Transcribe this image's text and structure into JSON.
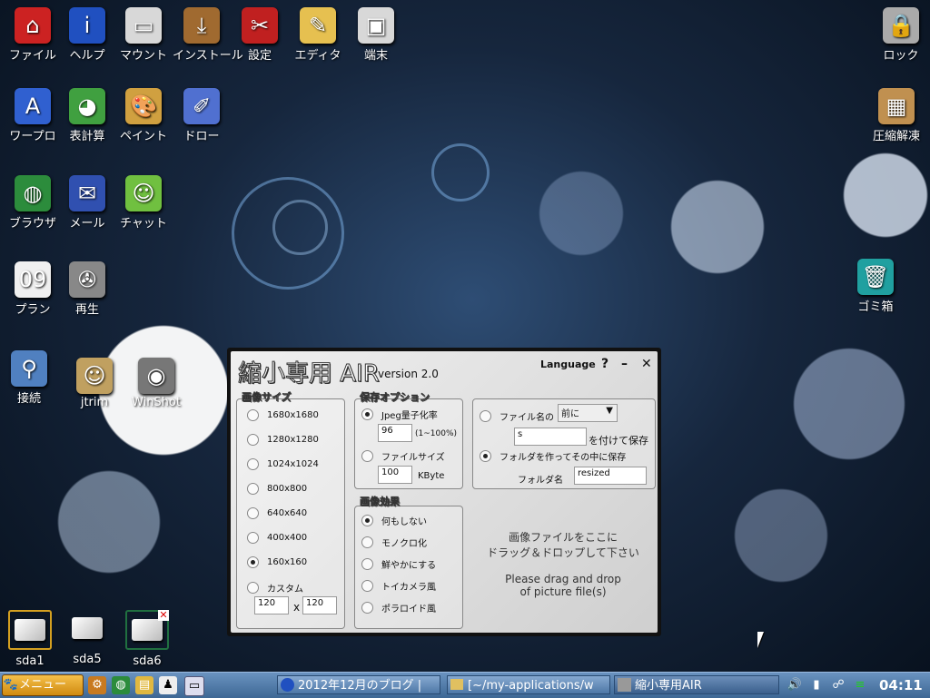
{
  "desktop": {
    "icons": [
      {
        "label": "ファイル",
        "icon": "home-icon",
        "color": "#cc2222",
        "glyph": "⌂"
      },
      {
        "label": "ヘルプ",
        "icon": "info-icon",
        "color": "#2050c0",
        "glyph": "i"
      },
      {
        "label": "マウント",
        "icon": "drive-icon",
        "color": "#d8d8d8",
        "glyph": "▭"
      },
      {
        "label": "インストール",
        "icon": "install-icon",
        "color": "#a06a30",
        "glyph": "⤓"
      },
      {
        "label": "設定",
        "icon": "settings-icon",
        "color": "#c02020",
        "glyph": "✂"
      },
      {
        "label": "エディタ",
        "icon": "editor-icon",
        "color": "#e6c050",
        "glyph": "✎"
      },
      {
        "label": "端末",
        "icon": "terminal-icon",
        "color": "#d8d8d8",
        "glyph": "▣"
      },
      {
        "label": "ワープロ",
        "icon": "wordprocessor-icon",
        "color": "#3060d0",
        "glyph": "A"
      },
      {
        "label": "表計算",
        "icon": "spreadsheet-icon",
        "color": "#40a040",
        "glyph": "◕"
      },
      {
        "label": "ペイント",
        "icon": "paint-icon",
        "color": "#d0a040",
        "glyph": "🎨"
      },
      {
        "label": "ドロー",
        "icon": "draw-icon",
        "color": "#5070d0",
        "glyph": "✐"
      },
      {
        "label": "ブラウザ",
        "icon": "browser-icon",
        "color": "#2c8c3c",
        "glyph": "◍"
      },
      {
        "label": "メール",
        "icon": "mail-icon",
        "color": "#3050b0",
        "glyph": "✉"
      },
      {
        "label": "チャット",
        "icon": "chat-icon",
        "color": "#70c040",
        "glyph": "☺"
      },
      {
        "label": "プラン",
        "icon": "calendar-icon",
        "color": "#f0f0f0",
        "glyph": "09"
      },
      {
        "label": "再生",
        "icon": "player-icon",
        "color": "#888888",
        "glyph": "✇"
      },
      {
        "label": "接続",
        "icon": "connect-icon",
        "color": "#5080c0",
        "glyph": "⚲"
      },
      {
        "label": "jtrim",
        "icon": "jtrim-icon",
        "color": "#c0a060",
        "glyph": "☺"
      },
      {
        "label": "WinShot",
        "icon": "winshot-icon",
        "color": "#777777",
        "glyph": "◉"
      },
      {
        "label": "ロック",
        "icon": "lock-icon",
        "color": "#aaaaaa",
        "glyph": "🔒"
      },
      {
        "label": "圧縮解凍",
        "icon": "archive-icon",
        "color": "#c09050",
        "glyph": "▦"
      },
      {
        "label": "ゴミ箱",
        "icon": "trash-icon",
        "color": "#20a0a0",
        "glyph": "🗑"
      }
    ],
    "drives": [
      {
        "label": "sda1"
      },
      {
        "label": "sda5"
      },
      {
        "label": "sda6"
      }
    ]
  },
  "window": {
    "title": "縮小専用 AIR",
    "version": "version 2.0",
    "language": "Language",
    "help": "?",
    "minimize": "–",
    "close": "✕",
    "size_group": {
      "title": "画像サイズ",
      "options": [
        "1680x1680",
        "1280x1280",
        "1024x1024",
        "800x800",
        "640x640",
        "400x400",
        "160x160",
        "カスタム"
      ],
      "selected": "160x160",
      "custom_w": "120",
      "custom_h": "120",
      "times": "x"
    },
    "save_group": {
      "title": "保存オプション",
      "jpeg_label": "Jpeg量子化率",
      "jpeg_value": "96",
      "jpeg_range": "(1~100%)",
      "filesize_label": "ファイルサイズ",
      "filesize_value": "100",
      "filesize_unit": "KByte"
    },
    "effect_group": {
      "title": "画像効果",
      "options": [
        "何もしない",
        "モノクロ化",
        "鮮やかにする",
        "トイカメラ風",
        "ポラロイド風"
      ],
      "selected": "何もしない"
    },
    "name_group": {
      "filename_label": "ファイル名の",
      "position_select": "前に",
      "suffix_value": "s",
      "suffix_text": "を付けて保存",
      "folder_label": "フォルダを作ってその中に保存",
      "folder_name_label": "フォルダ名",
      "folder_name_value": "resized"
    },
    "drop_jp_1": "画像ファイルをここに",
    "drop_jp_2": "ドラッグ＆ドロップして下さい",
    "drop_en_1": "Please drag and drop",
    "drop_en_2": "of picture file(s)"
  },
  "taskbar": {
    "menu_label": "メニュー",
    "tasks": [
      {
        "label": "2012年12月のブログ |"
      },
      {
        "label": "[~/my-applications/w"
      },
      {
        "label": "縮小専用AIR"
      }
    ],
    "clock": "04:11"
  }
}
